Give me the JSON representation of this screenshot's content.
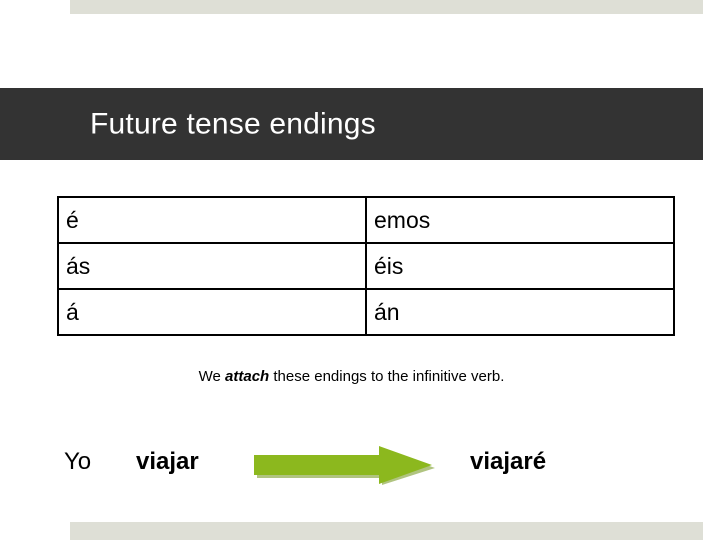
{
  "slide": {
    "title": "Future tense endings",
    "accent_dark": "#333333",
    "band_color": "#dedfd6",
    "arrow_color": "#8CB81E",
    "arrow_shadow": "#6f9318",
    "background": "#ffffff"
  },
  "endings_table": {
    "rows": [
      {
        "singular": "é",
        "plural": "emos"
      },
      {
        "singular": "ás",
        "plural": "éis"
      },
      {
        "singular": "á",
        "plural": "án"
      }
    ]
  },
  "explanation": {
    "before": "We ",
    "emphasis": "attach",
    "after": " these endings to the infinitive verb."
  },
  "example": {
    "subject": "Yo",
    "infinitive": "viajar",
    "arrow_icon": "right-arrow-icon",
    "result": "viajaré"
  }
}
